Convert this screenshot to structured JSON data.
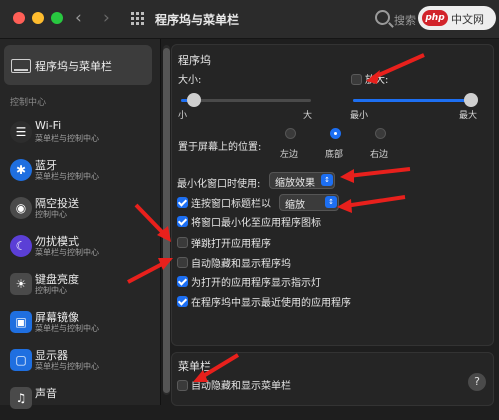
{
  "window": {
    "title": "程序坞与菜单栏"
  },
  "search": {
    "label": "搜索"
  },
  "watermark": {
    "logo": "php",
    "text": "中文网"
  },
  "sidebar": {
    "selected": {
      "label": "程序坞与菜单栏"
    },
    "group_label": "控制中心",
    "items": [
      {
        "name": "Wi-Fi",
        "sub": "菜单栏与控制中心"
      },
      {
        "name": "蓝牙",
        "sub": "菜单栏与控制中心"
      },
      {
        "name": "隔空投送",
        "sub": "控制中心"
      },
      {
        "name": "勿扰模式",
        "sub": "菜单栏与控制中心"
      },
      {
        "name": "键盘亮度",
        "sub": "控制中心"
      },
      {
        "name": "屏幕镜像",
        "sub": "菜单栏与控制中心"
      },
      {
        "name": "显示器",
        "sub": "菜单栏与控制中心"
      },
      {
        "name": "声音",
        "sub": ""
      }
    ]
  },
  "dock": {
    "header": "程序坞",
    "size_label": "大小:",
    "size_min": "小",
    "size_max": "大",
    "size_value": 0.1,
    "magnify_label": "放大:",
    "magnify_checked": false,
    "magnify_min": "最小",
    "magnify_max": "最大",
    "magnify_value": 1.0,
    "position_label": "置于屏幕上的位置:",
    "positions": [
      "左边",
      "底部",
      "右边"
    ],
    "position_selected": "底部",
    "minimize_label": "最小化窗口时使用:",
    "minimize_value": "缩放效果",
    "options": [
      {
        "label": "连按窗口标题栏以",
        "checked": true,
        "popup": "缩放"
      },
      {
        "label": "将窗口最小化至应用程序图标",
        "checked": true
      },
      {
        "label": "弹跳打开应用程序",
        "checked": false
      },
      {
        "label": "自动隐藏和显示程序坞",
        "checked": false
      },
      {
        "label": "为打开的应用程序显示指示灯",
        "checked": true
      },
      {
        "label": "在程序坞中显示最近使用的应用程序",
        "checked": true
      }
    ]
  },
  "menubar": {
    "header": "菜单栏",
    "autohide_label": "自动隐藏和显示菜单栏",
    "autohide_checked": false
  },
  "help": {
    "label": "?"
  },
  "colors": {
    "accent": "#1d6ff2",
    "annotation_arrow": "#e8201c"
  }
}
